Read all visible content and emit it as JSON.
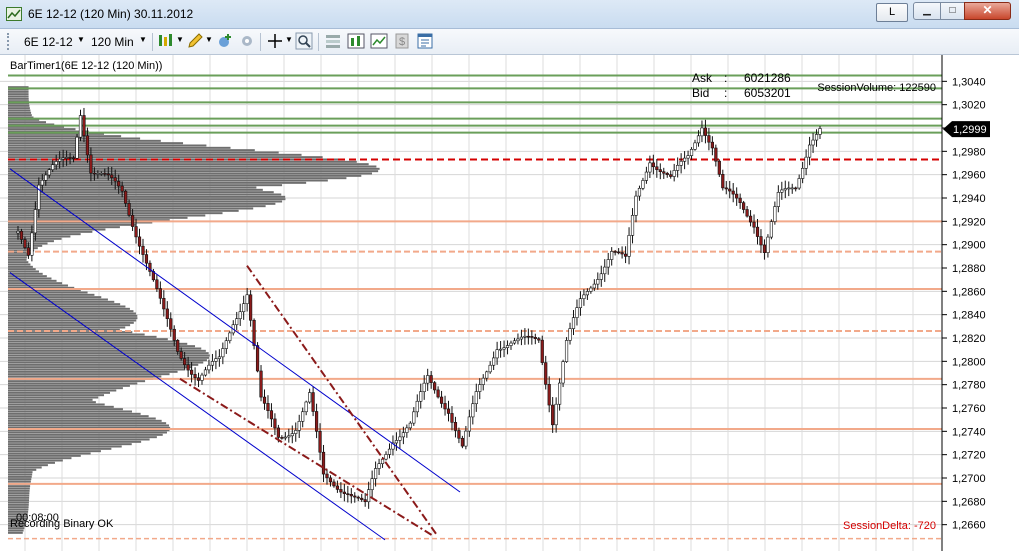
{
  "window": {
    "title": "6E 12-12 (120 Min)  30.11.2012",
    "layout_button": "L",
    "min_glyph": "▁",
    "max_glyph": "□",
    "close_glyph": "✕"
  },
  "toolbar": {
    "instrument": "6E 12-12",
    "interval": "120 Min",
    "icons": [
      "candlestick-style-icon",
      "pencil-draw-icon",
      "add-indicator-icon",
      "strategy-icon",
      "crosshair-icon",
      "zoom-icon",
      "data-box-icon",
      "chart-properties-icon",
      "line-chart-icon",
      "dollar-icon",
      "template-icon"
    ]
  },
  "colors": {
    "bull_candle": "#ffffff",
    "bear_candle": "#8b1a1a",
    "wick": "#111111",
    "volume_profile": "#6e6e6e",
    "green_level": "#6a9f5a",
    "salmon_level": "#f2a98a",
    "red_dashed": "#d40000",
    "channel": "#0000cc",
    "wedge": "#8b1a1a",
    "price_marker_bg": "#000000",
    "session_delta": "#d40000"
  },
  "chart": {
    "indicator_label": "BarTimer1(6E 12-12 (120 Min))",
    "ask_label": "Ask",
    "ask_value": "6021286",
    "bid_label": "Bid",
    "bid_value": "6053201",
    "session_volume": "SessionVolume: 122590",
    "session_delta": "SessionDelta: -720",
    "bar_timer": "00:08:00",
    "status": "Recording Binary OK",
    "current_price": "1,2999",
    "y_min": 1.2646,
    "y_max": 1.3054,
    "y_ticks": [
      1.304,
      1.302,
      1.3,
      1.298,
      1.296,
      1.294,
      1.292,
      1.29,
      1.288,
      1.286,
      1.284,
      1.282,
      1.28,
      1.278,
      1.276,
      1.274,
      1.272,
      1.27,
      1.268,
      1.266
    ],
    "y_tick_labels": [
      "1,3040",
      "1,3020",
      "1,3000",
      "1,2980",
      "1,2960",
      "1,2940",
      "1,2920",
      "1,2900",
      "1,2880",
      "1,2860",
      "1,2840",
      "1,2820",
      "1,2800",
      "1,2780",
      "1,2760",
      "1,2740",
      "1,2720",
      "1,2700",
      "1,2680",
      "1,2660"
    ],
    "green_levels": [
      1.3045,
      1.3034,
      1.3022,
      1.3008,
      1.3002,
      1.2996
    ],
    "salmon_solid_levels": [
      1.292,
      1.2862,
      1.2785,
      1.2742,
      1.2695
    ],
    "salmon_dashed_levels": [
      1.2894,
      1.2826
    ],
    "red_dashed_level": 1.2973,
    "bottom_dashed_level": 1.2648
  },
  "chart_data": {
    "type": "candlestick",
    "y_axis_ticks": [
      "1,3040",
      "1,3020",
      "1,3000",
      "1,2980",
      "1,2960",
      "1,2940",
      "1,2920",
      "1,2900",
      "1,2880",
      "1,2860",
      "1,2840",
      "1,2820",
      "1,2800",
      "1,2780",
      "1,2760",
      "1,2740",
      "1,2720",
      "1,2700",
      "1,2680",
      "1,2660"
    ],
    "ylim": [
      1.2646,
      1.3054
    ],
    "price_path_keypoints": [
      {
        "bar": 0,
        "price": 1.291
      },
      {
        "bar": 3,
        "price": 1.2895
      },
      {
        "bar": 6,
        "price": 1.2955
      },
      {
        "bar": 10,
        "price": 1.2965
      },
      {
        "bar": 16,
        "price": 1.2975
      },
      {
        "bar": 18,
        "price": 1.3015
      },
      {
        "bar": 21,
        "price": 1.2965
      },
      {
        "bar": 26,
        "price": 1.2955
      },
      {
        "bar": 30,
        "price": 1.2945
      },
      {
        "bar": 36,
        "price": 1.2895
      },
      {
        "bar": 42,
        "price": 1.284
      },
      {
        "bar": 46,
        "price": 1.281
      },
      {
        "bar": 52,
        "price": 1.2785
      },
      {
        "bar": 58,
        "price": 1.28
      },
      {
        "bar": 62,
        "price": 1.2835
      },
      {
        "bar": 66,
        "price": 1.286
      },
      {
        "bar": 70,
        "price": 1.2765
      },
      {
        "bar": 75,
        "price": 1.2735
      },
      {
        "bar": 80,
        "price": 1.2745
      },
      {
        "bar": 84,
        "price": 1.277
      },
      {
        "bar": 88,
        "price": 1.27
      },
      {
        "bar": 95,
        "price": 1.269
      },
      {
        "bar": 100,
        "price": 1.2675
      },
      {
        "bar": 103,
        "price": 1.2705
      },
      {
        "bar": 108,
        "price": 1.2735
      },
      {
        "bar": 113,
        "price": 1.2745
      },
      {
        "bar": 118,
        "price": 1.2785
      },
      {
        "bar": 124,
        "price": 1.276
      },
      {
        "bar": 128,
        "price": 1.2725
      },
      {
        "bar": 132,
        "price": 1.277
      },
      {
        "bar": 138,
        "price": 1.2815
      },
      {
        "bar": 144,
        "price": 1.2815
      },
      {
        "bar": 150,
        "price": 1.282
      },
      {
        "bar": 154,
        "price": 1.275
      },
      {
        "bar": 158,
        "price": 1.2815
      },
      {
        "bar": 162,
        "price": 1.285
      },
      {
        "bar": 166,
        "price": 1.287
      },
      {
        "bar": 171,
        "price": 1.2895
      },
      {
        "bar": 175,
        "price": 1.2885
      },
      {
        "bar": 178,
        "price": 1.294
      },
      {
        "bar": 182,
        "price": 1.2975
      },
      {
        "bar": 188,
        "price": 1.2955
      },
      {
        "bar": 193,
        "price": 1.2975
      },
      {
        "bar": 197,
        "price": 1.3005
      },
      {
        "bar": 200,
        "price": 1.2985
      },
      {
        "bar": 203,
        "price": 1.2945
      },
      {
        "bar": 208,
        "price": 1.2935
      },
      {
        "bar": 212,
        "price": 1.292
      },
      {
        "bar": 215,
        "price": 1.2895
      },
      {
        "bar": 219,
        "price": 1.294
      },
      {
        "bar": 224,
        "price": 1.295
      },
      {
        "bar": 228,
        "price": 1.299
      },
      {
        "bar": 231,
        "price": 1.2999
      }
    ],
    "volume_profile_note": "horizontal volume-at-price histogram on left",
    "grid": true
  }
}
